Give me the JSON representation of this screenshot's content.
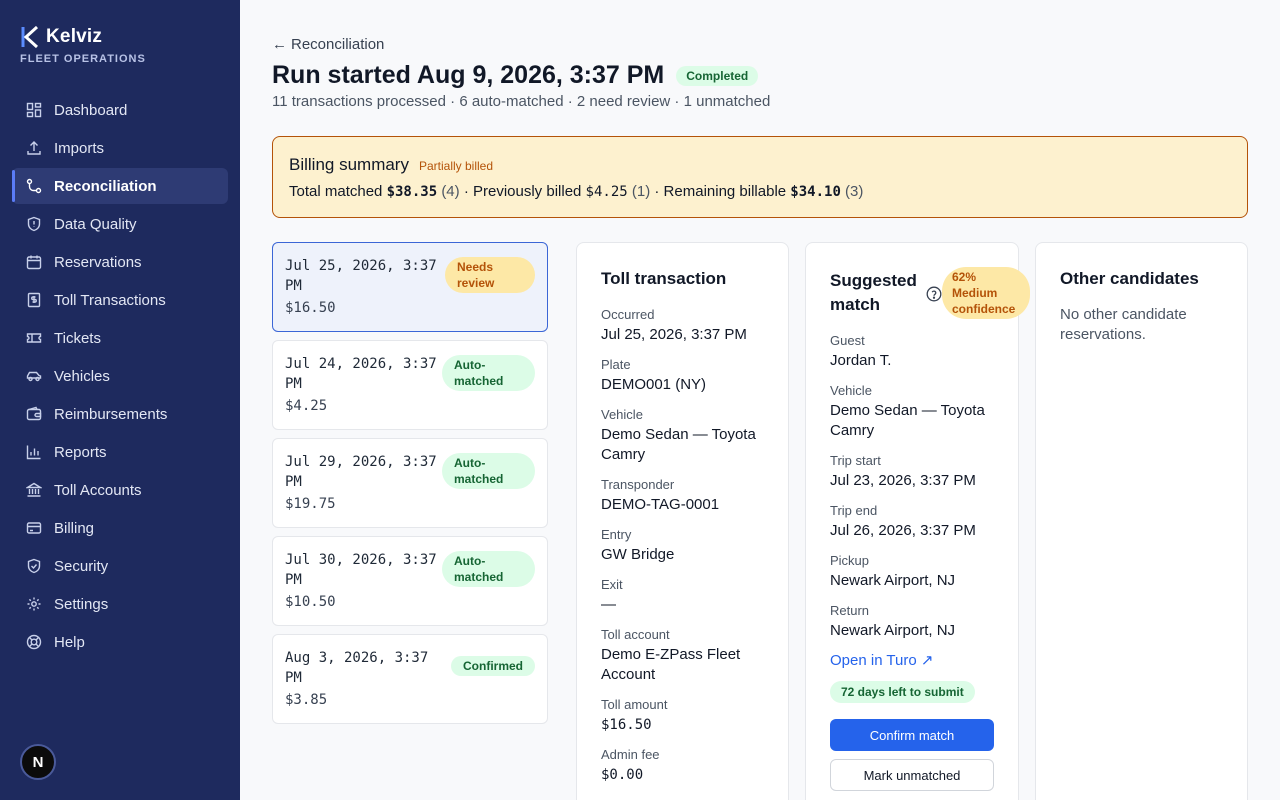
{
  "brand": {
    "name": "Kelviz",
    "subtitle": "FLEET OPERATIONS"
  },
  "sidebar": {
    "items": [
      {
        "label": "Dashboard",
        "icon": "dashboard-icon",
        "active": false
      },
      {
        "label": "Imports",
        "icon": "upload-icon",
        "active": false
      },
      {
        "label": "Reconciliation",
        "icon": "reconcile-icon",
        "active": true
      },
      {
        "label": "Data Quality",
        "icon": "shield-icon",
        "active": false
      },
      {
        "label": "Reservations",
        "icon": "calendar-icon",
        "active": false
      },
      {
        "label": "Toll Transactions",
        "icon": "receipt-icon",
        "active": false
      },
      {
        "label": "Tickets",
        "icon": "ticket-icon",
        "active": false
      },
      {
        "label": "Vehicles",
        "icon": "car-icon",
        "active": false
      },
      {
        "label": "Reimbursements",
        "icon": "wallet-icon",
        "active": false
      },
      {
        "label": "Reports",
        "icon": "chart-icon",
        "active": false
      },
      {
        "label": "Toll Accounts",
        "icon": "bank-icon",
        "active": false
      },
      {
        "label": "Billing",
        "icon": "credit-card-icon",
        "active": false
      },
      {
        "label": "Security",
        "icon": "shield-check-icon",
        "active": false
      },
      {
        "label": "Settings",
        "icon": "gear-icon",
        "active": false
      },
      {
        "label": "Help",
        "icon": "lifebuoy-icon",
        "active": false
      }
    ],
    "avatar_initial": "N"
  },
  "header": {
    "back_label": "Reconciliation",
    "title": "Run started Aug 9, 2026, 3:37 PM",
    "status": "Completed",
    "subtitle": "11 transactions processed · 6 auto-matched · 2 need review · 1 unmatched"
  },
  "billing": {
    "title": "Billing summary",
    "status": "Partially billed",
    "matched_label": "Total matched",
    "matched_amount": "$38.35",
    "matched_count": "(4)",
    "prev_label": "· Previously billed",
    "prev_amount": "$4.25",
    "prev_count": "(1)",
    "remaining_label": "· Remaining billable",
    "remaining_amount": "$34.10",
    "remaining_count": "(3)"
  },
  "transactions": [
    {
      "date": "Jul 25, 2026, 3:37 PM",
      "amount": "$16.50",
      "status": "Needs review",
      "selected": true
    },
    {
      "date": "Jul 24, 2026, 3:37 PM",
      "amount": "$4.25",
      "status": "Auto-matched",
      "selected": false
    },
    {
      "date": "Jul 29, 2026, 3:37 PM",
      "amount": "$19.75",
      "status": "Auto-matched",
      "selected": false
    },
    {
      "date": "Jul 30, 2026, 3:37 PM",
      "amount": "$10.50",
      "status": "Auto-matched",
      "selected": false
    },
    {
      "date": "Aug 3, 2026, 3:37 PM",
      "amount": "$3.85",
      "status": "Confirmed",
      "selected": false
    }
  ],
  "toll": {
    "title": "Toll transaction",
    "fields": [
      {
        "label": "Occurred",
        "value": "Jul 25, 2026, 3:37 PM"
      },
      {
        "label": "Plate",
        "value": "DEMO001 (NY)"
      },
      {
        "label": "Vehicle",
        "value": "Demo Sedan — Toyota Camry"
      },
      {
        "label": "Transponder",
        "value": "DEMO-TAG-0001"
      },
      {
        "label": "Entry",
        "value": "GW Bridge"
      },
      {
        "label": "Exit",
        "value": "—"
      },
      {
        "label": "Toll account",
        "value": "Demo E-ZPass Fleet Account"
      },
      {
        "label": "Toll amount",
        "value": "$16.50"
      },
      {
        "label": "Admin fee",
        "value": "$0.00"
      }
    ]
  },
  "suggested": {
    "title": "Suggested match",
    "confidence": "62% Medium confidence",
    "fields": [
      {
        "label": "Guest",
        "value": "Jordan T."
      },
      {
        "label": "Vehicle",
        "value": "Demo Sedan — Toyota Camry"
      },
      {
        "label": "Trip start",
        "value": "Jul 23, 2026, 3:37 PM"
      },
      {
        "label": "Trip end",
        "value": "Jul 26, 2026, 3:37 PM"
      },
      {
        "label": "Pickup",
        "value": "Newark Airport, NJ"
      },
      {
        "label": "Return",
        "value": "Newark Airport, NJ"
      }
    ],
    "link_label": "Open in Turo ↗",
    "days_left": "72 days left to submit",
    "confirm_label": "Confirm match",
    "unmatched_label": "Mark unmatched"
  },
  "other": {
    "title": "Other candidates",
    "empty": "No other candidate reservations."
  }
}
